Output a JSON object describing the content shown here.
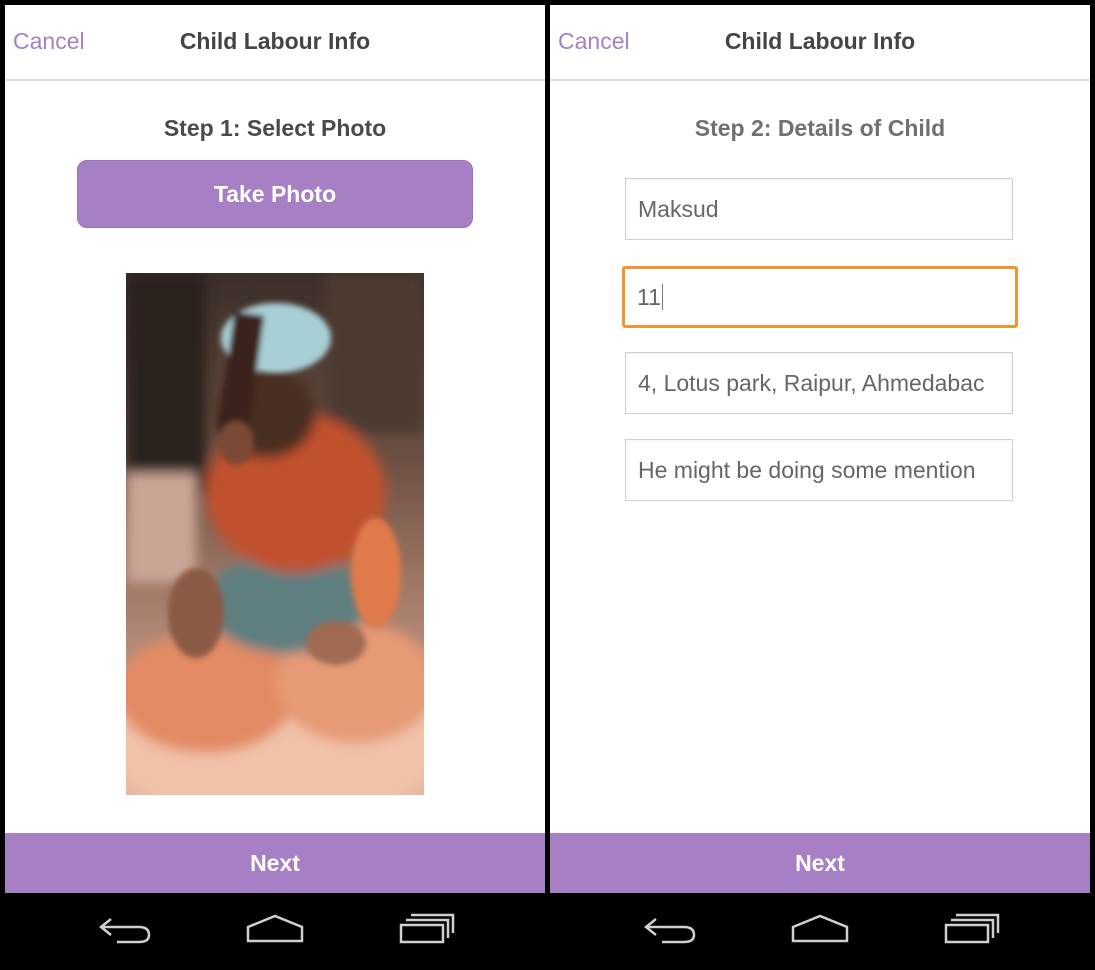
{
  "screens": {
    "left": {
      "header": {
        "cancel_label": "Cancel",
        "title": "Child Labour Info"
      },
      "step_title": "Step 1: Select Photo",
      "take_photo_label": "Take Photo",
      "photo": {
        "icon": "child-labour-photo"
      },
      "next_label": "Next",
      "nav": {
        "back_icon": "back-icon",
        "home_icon": "home-icon",
        "recents_icon": "recents-icon"
      }
    },
    "right": {
      "header": {
        "cancel_label": "Cancel",
        "title": "Child Labour Info"
      },
      "step_title": "Step 2: Details of Child",
      "fields": {
        "name": {
          "value": "Maksud"
        },
        "age": {
          "value": "11"
        },
        "address": {
          "value": "4, Lotus park, Raipur, Ahmedabac"
        },
        "description": {
          "value": "He might be doing some mention"
        }
      },
      "next_label": "Next",
      "nav": {
        "back_icon": "back-icon",
        "home_icon": "home-icon",
        "recents_icon": "recents-icon"
      }
    }
  },
  "colors": {
    "accent": "#a77fc4",
    "focus": "#f0962f",
    "header_divider": "#dedede",
    "background": "#ffffff"
  }
}
